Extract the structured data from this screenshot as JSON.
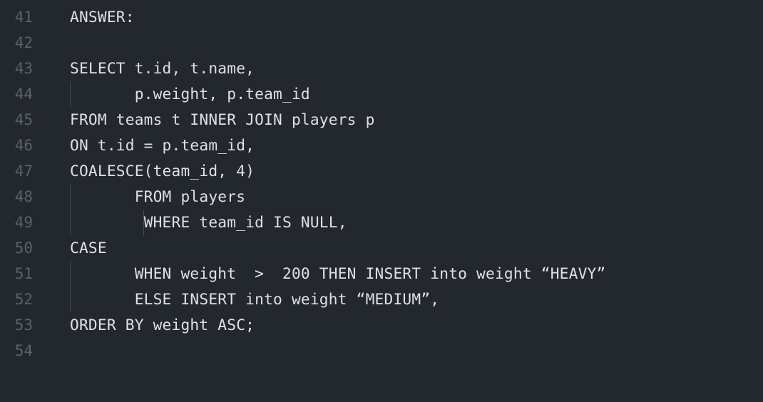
{
  "editor": {
    "lines": [
      {
        "number": "41",
        "text": "ANSWER:"
      },
      {
        "number": "42",
        "text": ""
      },
      {
        "number": "43",
        "text": "SELECT t.id, t.name,"
      },
      {
        "number": "44",
        "text": "       p.weight, p.team_id"
      },
      {
        "number": "45",
        "text": "FROM teams t INNER JOIN players p"
      },
      {
        "number": "46",
        "text": "ON t.id = p.team_id,"
      },
      {
        "number": "47",
        "text": "COALESCE(team_id, 4)"
      },
      {
        "number": "48",
        "text": "       FROM players"
      },
      {
        "number": "49",
        "text": "        WHERE team_id IS NULL,"
      },
      {
        "number": "50",
        "text": "CASE"
      },
      {
        "number": "51",
        "text": "       WHEN weight  >  200 THEN INSERT into weight “HEAVY”"
      },
      {
        "number": "52",
        "text": "       ELSE INSERT into weight “MEDIUM”,"
      },
      {
        "number": "53",
        "text": "ORDER BY weight ASC;"
      },
      {
        "number": "54",
        "text": ""
      }
    ]
  },
  "colors": {
    "background": "#23272e",
    "text": "#dde1e6",
    "line_number": "#5b616b",
    "indent_guide": "#454a52"
  }
}
